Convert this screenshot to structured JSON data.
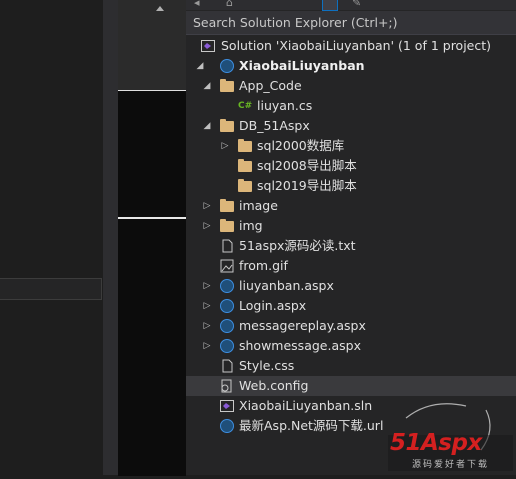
{
  "explorer": {
    "search_placeholder": "Search Solution Explorer (Ctrl+;)",
    "solution_label": "Solution 'XiaobaiLiuyanban' (1 of 1 project)",
    "project_label": "XiaobaiLiuyanban",
    "items": [
      {
        "label": "App_Code",
        "icon": "folder-icon",
        "expanded": true
      },
      {
        "label": "liuyan.cs",
        "icon": "csharp-file-icon"
      },
      {
        "label": "DB_51Aspx",
        "icon": "folder-icon",
        "expanded": true
      },
      {
        "label": "sql2000数据库",
        "icon": "folder-icon",
        "expanded": false
      },
      {
        "label": "sql2008导出脚本",
        "icon": "folder-icon"
      },
      {
        "label": "sql2019导出脚本",
        "icon": "folder-icon"
      },
      {
        "label": "image",
        "icon": "folder-icon",
        "expanded": false
      },
      {
        "label": "img",
        "icon": "folder-icon",
        "expanded": false
      },
      {
        "label": "51aspx源码必读.txt",
        "icon": "text-file-icon"
      },
      {
        "label": "from.gif",
        "icon": "image-file-icon"
      },
      {
        "label": "liuyanban.aspx",
        "icon": "web-page-icon",
        "expanded": false
      },
      {
        "label": "Login.aspx",
        "icon": "web-page-icon",
        "expanded": false
      },
      {
        "label": "messagereplay.aspx",
        "icon": "web-page-icon",
        "expanded": false
      },
      {
        "label": "showmessage.aspx",
        "icon": "web-page-icon",
        "expanded": false
      },
      {
        "label": "Style.css",
        "icon": "css-file-icon"
      },
      {
        "label": "Web.config",
        "icon": "config-file-icon"
      },
      {
        "label": "XiaobaiLiuyanban.sln",
        "icon": "solution-file-icon"
      },
      {
        "label": "最新Asp.Net源码下载.url",
        "icon": "url-file-icon"
      }
    ]
  },
  "watermark": {
    "brand": "51Aspx",
    "tagline": "源码爱好者下载"
  },
  "colors": {
    "background": "#1e1e1e",
    "panel": "#252526",
    "folder": "#dcb67a",
    "csharp": "#68b723",
    "accent": "#0e70c0",
    "watermark_red": "#d42020"
  }
}
